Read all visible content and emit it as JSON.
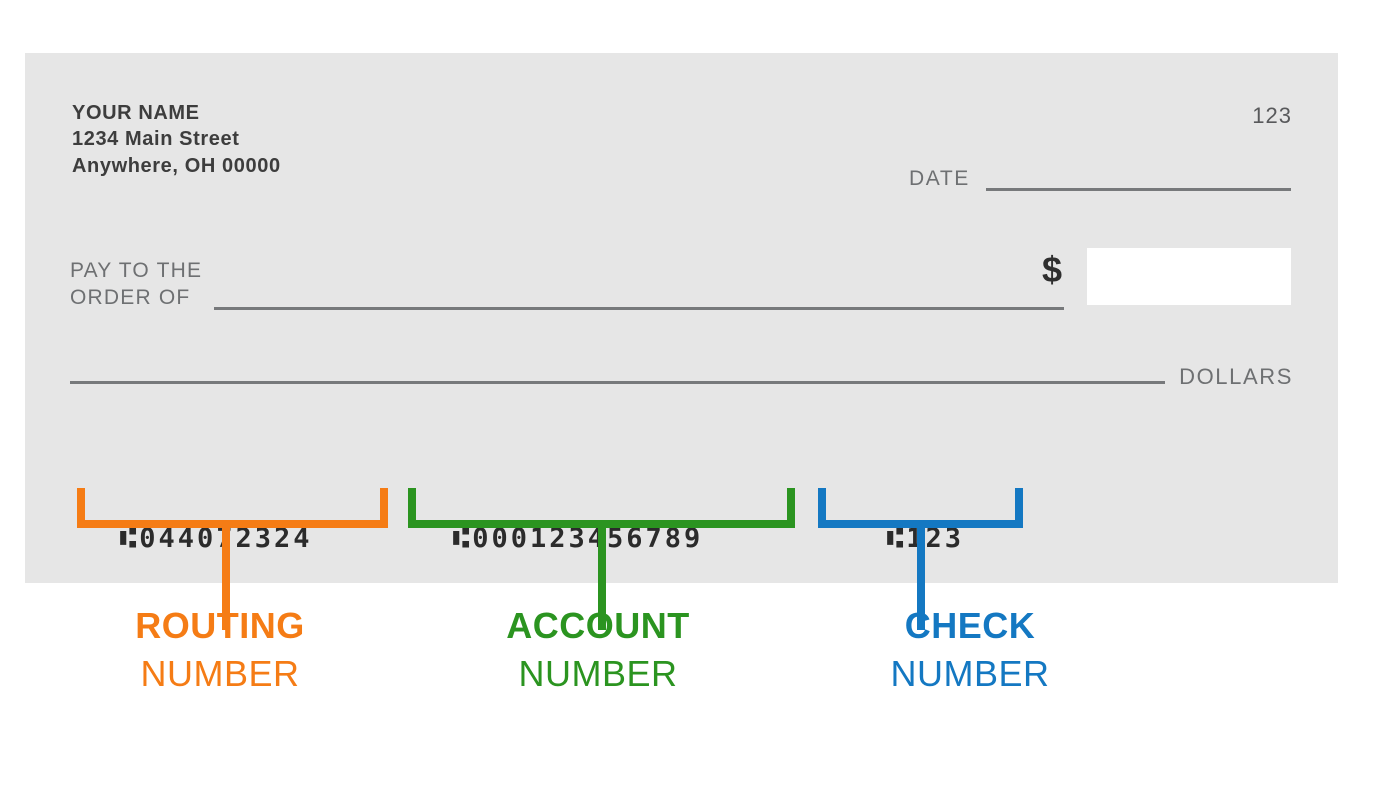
{
  "check": {
    "payer": {
      "name": "YOUR NAME",
      "address_line1": "1234 Main Street",
      "address_line2": "Anywhere, OH 00000"
    },
    "check_number_top_right": "123",
    "date_label": "DATE",
    "pay_to_line1": "PAY TO THE",
    "pay_to_line2": "ORDER OF",
    "currency_symbol": "$",
    "amount_value": "",
    "dollars_label": "DOLLARS",
    "micr": {
      "routing": "⑆044072324",
      "account": "⑆000123456789",
      "check": "⑆123"
    }
  },
  "callouts": [
    {
      "id": "routing",
      "title": "ROUTING",
      "subtitle": "NUMBER",
      "color": "#f57c15",
      "value": "044072324"
    },
    {
      "id": "account",
      "title": "ACCOUNT",
      "subtitle": "NUMBER",
      "color": "#2b9420",
      "value": "000123456789"
    },
    {
      "id": "check",
      "title": "CHECK",
      "subtitle": "NUMBER",
      "color": "#1478c2",
      "value": "123"
    }
  ],
  "colors": {
    "panel_background": "#e6e6e6",
    "page_background": "#ffffff",
    "rule": "#77797b",
    "text_dark": "#3d3d3d",
    "text_gray": "#6e7072"
  }
}
